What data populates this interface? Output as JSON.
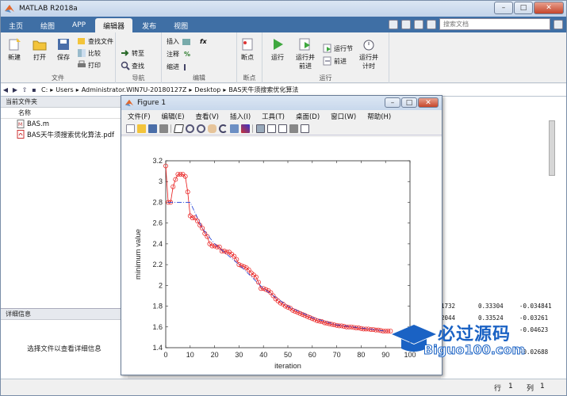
{
  "window": {
    "title": "MATLAB R2018a"
  },
  "tabs": [
    "主页",
    "绘图",
    "APP",
    "编辑器",
    "发布",
    "视图"
  ],
  "active_tab": 3,
  "search": {
    "placeholder": "搜索文档"
  },
  "ribbon": {
    "file_group": {
      "label": "文件",
      "new": "新建",
      "open": "打开",
      "save": "保存",
      "find_files": "查找文件",
      "compare": "比较",
      "print": "打印"
    },
    "nav_group": {
      "label": "导航",
      "goto": "转至",
      "find": "查找"
    },
    "edit_group": {
      "label": "编辑",
      "insert": "插入",
      "comment": "注释",
      "indent": "缩进"
    },
    "breakpoint_group": {
      "label": "断点",
      "breakpoints": "断点"
    },
    "run_group": {
      "label": "运行",
      "run": "运行",
      "run_advance": "运行并\n前进",
      "run_section": "运行节",
      "advance": "前进",
      "run_time": "运行并\n计时"
    }
  },
  "address": {
    "parts": [
      "C:",
      "Users",
      "Administrator.WIN7U-20180127Z",
      "Desktop",
      "BAS天牛须搜索优化算法"
    ]
  },
  "current_folder": {
    "title": "当前文件夹",
    "col_name": "名称",
    "files": [
      "BAS.m",
      "BAS天牛须搜索优化算法.pdf"
    ]
  },
  "details": {
    "title": "详细信息",
    "message": "选择文件以查看详细信息"
  },
  "workspace_values": [
    {
      "a": "1732",
      "b": "0.33304",
      "c": "-0.034841"
    },
    {
      "a": "2044",
      "b": "0.33524",
      "c": "-0.03261"
    },
    {
      "a": "",
      "b": "",
      "c": "-0.04623"
    },
    {
      "a": "",
      "b": "",
      "c": "-0.02688"
    }
  ],
  "status": {
    "row_label": "行",
    "row": "1",
    "col_label": "列",
    "col": "1"
  },
  "figure": {
    "title": "Figure 1",
    "menu": [
      "文件(F)",
      "编辑(E)",
      "查看(V)",
      "插入(I)",
      "工具(T)",
      "桌面(D)",
      "窗口(W)",
      "帮助(H)"
    ]
  },
  "chart_data": {
    "type": "line",
    "xlabel": "iteration",
    "ylabel": "minimum value",
    "xlim": [
      0,
      100
    ],
    "ylim": [
      1.4,
      3.2
    ],
    "xticks": [
      0,
      10,
      20,
      30,
      40,
      50,
      60,
      70,
      80,
      90,
      100
    ],
    "yticks": [
      1.4,
      1.6,
      1.8,
      2,
      2.2,
      2.4,
      2.6,
      2.8,
      3,
      3.2
    ],
    "series": [
      {
        "color": "#e81818",
        "marker": "circle",
        "x": [
          0,
          1,
          2,
          3,
          4,
          5,
          6,
          7,
          8,
          9,
          10,
          11,
          12,
          13,
          14,
          15,
          16,
          17,
          18,
          19,
          20,
          21,
          22,
          23,
          24,
          25,
          26,
          27,
          28,
          29,
          30,
          31,
          32,
          33,
          34,
          35,
          36,
          37,
          38,
          39,
          40,
          41,
          42,
          43,
          44,
          45,
          46,
          47,
          48,
          49,
          50,
          51,
          52,
          53,
          54,
          55,
          56,
          57,
          58,
          59,
          60,
          61,
          62,
          63,
          64,
          65,
          66,
          67,
          68,
          69,
          70,
          71,
          72,
          73,
          74,
          75,
          76,
          77,
          78,
          79,
          80,
          81,
          82,
          83,
          84,
          85,
          86,
          87,
          88,
          89,
          90,
          91,
          92
        ],
        "values": [
          3.15,
          2.8,
          2.8,
          2.95,
          3.02,
          3.07,
          3.07,
          3.07,
          3.05,
          2.9,
          2.67,
          2.65,
          2.65,
          2.62,
          2.58,
          2.55,
          2.5,
          2.47,
          2.4,
          2.38,
          2.38,
          2.37,
          2.37,
          2.33,
          2.33,
          2.32,
          2.32,
          2.3,
          2.28,
          2.25,
          2.2,
          2.19,
          2.18,
          2.17,
          2.15,
          2.12,
          2.1,
          2.08,
          2.03,
          1.97,
          1.97,
          1.96,
          1.95,
          1.93,
          1.9,
          1.87,
          1.85,
          1.83,
          1.82,
          1.8,
          1.79,
          1.78,
          1.76,
          1.75,
          1.74,
          1.73,
          1.72,
          1.71,
          1.7,
          1.69,
          1.68,
          1.67,
          1.66,
          1.655,
          1.65,
          1.64,
          1.635,
          1.63,
          1.625,
          1.62,
          1.615,
          1.61,
          1.61,
          1.605,
          1.6,
          1.6,
          1.6,
          1.595,
          1.59,
          1.59,
          1.585,
          1.58,
          1.58,
          1.58,
          1.575,
          1.575,
          1.57,
          1.57,
          1.565,
          1.56,
          1.56,
          1.56,
          1.56
        ]
      },
      {
        "color": "#1f3fd6",
        "marker": "none",
        "style": "dash-dot",
        "x": [
          1,
          2,
          3,
          4,
          5,
          6,
          7,
          8,
          9,
          10,
          15,
          20,
          30,
          40,
          50,
          60,
          70,
          80,
          90
        ],
        "values": [
          2.8,
          2.8,
          2.8,
          2.8,
          2.8,
          2.8,
          2.8,
          2.8,
          2.8,
          2.8,
          2.55,
          2.4,
          2.2,
          1.97,
          1.8,
          1.69,
          1.62,
          1.59,
          1.56
        ]
      }
    ]
  },
  "watermark": {
    "title": "必过源码",
    "url": "Biguo100.com"
  },
  "colors": {
    "tab_bar": "#3f6fa5",
    "line": "#e81818",
    "line2": "#1f3fd6",
    "watermark": "#1a62c4"
  }
}
